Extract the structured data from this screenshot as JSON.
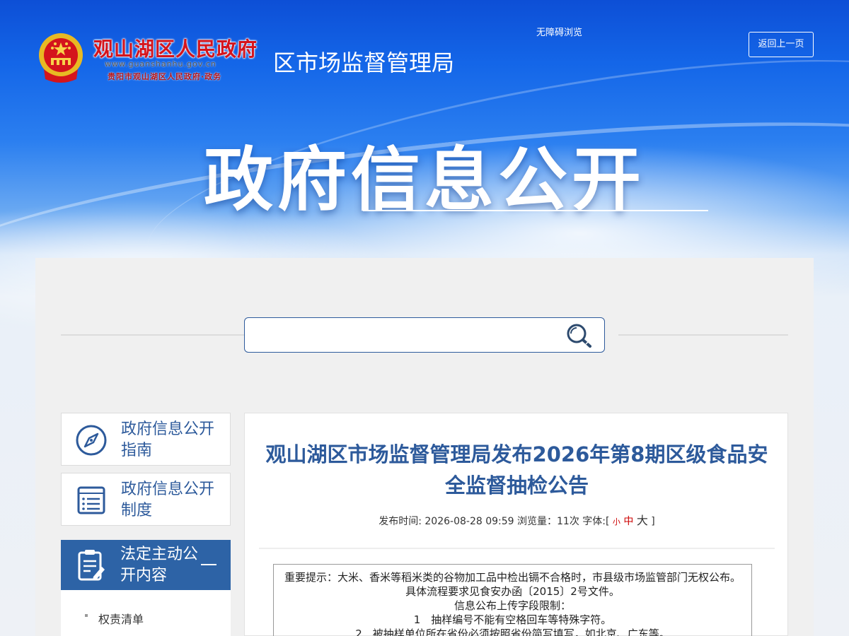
{
  "header": {
    "site_name": "观山湖区人民政府",
    "site_url": "www.guanshanhu.gov.cn",
    "site_sub": "贵阳市观山湖区人民政府·政务",
    "department": "区市场监督管理局",
    "accessible_link": "无障碍浏览",
    "back_button": "返回上一页"
  },
  "hero": {
    "title": "政府信息公开"
  },
  "search": {
    "placeholder": "",
    "icon": "search-icon"
  },
  "sidebar": {
    "items": [
      {
        "label": "政府信息公开指南",
        "icon": "compass-icon"
      },
      {
        "label": "政府信息公开制度",
        "icon": "list-document-icon"
      },
      {
        "label": "法定主动公开内容",
        "icon": "edit-document-icon",
        "active": true
      }
    ],
    "submenu": [
      {
        "label": "权责清单"
      }
    ]
  },
  "article": {
    "title": "观山湖区市场监督管理局发布2026年第8期区级食品安全监督抽检公告",
    "meta_prefix": "发布时间: 2026-08-28 09:59 浏览量：11次 字体:[",
    "font_small": "小",
    "font_mid": "中",
    "font_big": "大",
    "meta_suffix": "]",
    "notice": [
      "重要提示：大米、香米等稻米类的谷物加工品中检出镉不合格时，市县级市场监管部门无权公布。具体流程要求见食安办函〔2015〕2号文件。",
      "信息公布上传字段限制：",
      "1　抽样编号不能有空格回车等特殊字符。",
      "2　被抽样单位所在省份必须按照省份简写填写，如北京、广东等。"
    ]
  },
  "colors": {
    "banner_blue": "#1466e8",
    "brand_red": "#d4141c",
    "accent_blue": "#2d5a9b",
    "active_blue": "#2d63a6"
  }
}
